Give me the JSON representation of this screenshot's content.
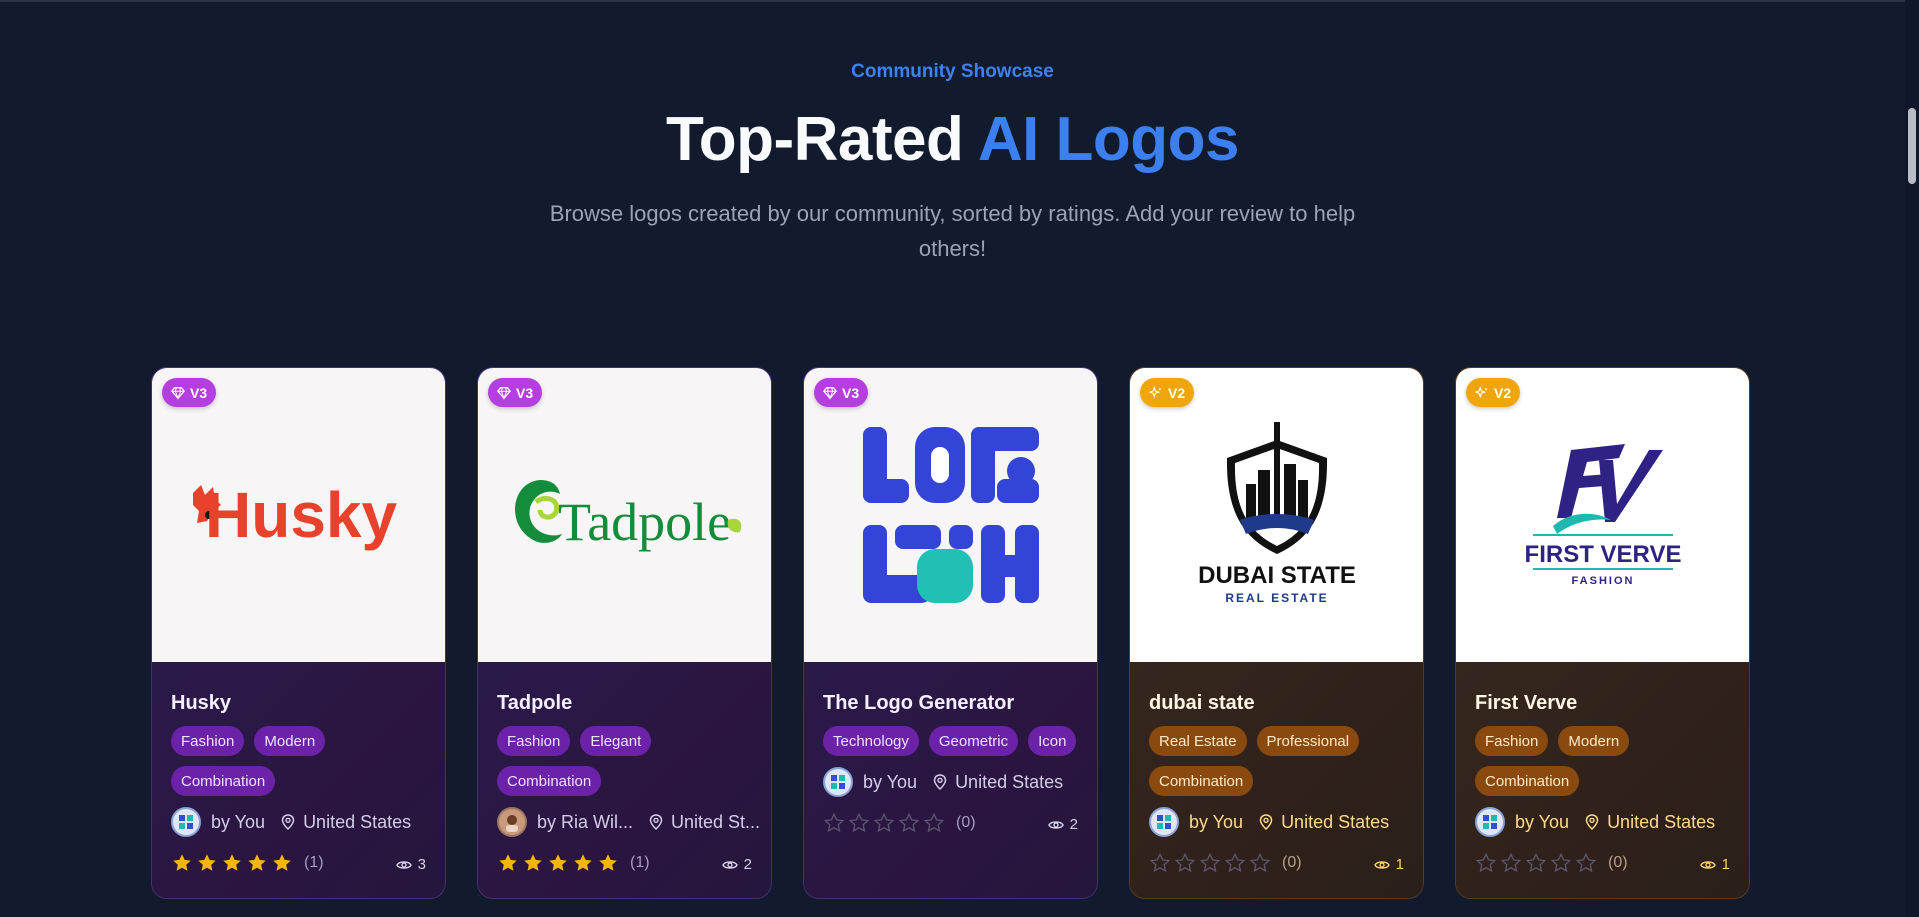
{
  "hero": {
    "eyebrow": "Community Showcase",
    "title_main": "Top-Rated",
    "title_accent": "AI Logos",
    "subtitle": "Browse logos created by our community, sorted by ratings. Add your review to help others!"
  },
  "colors": {
    "accent": "#3b7ff0",
    "v3_badge": "#b43ee0",
    "v2_badge": "#f0a50a",
    "star_filled": "#f5b50a"
  },
  "cards": [
    {
      "version": "V3",
      "logo_text": "Husky",
      "name": "Husky",
      "tags": [
        "Fashion",
        "Modern",
        "Combination"
      ],
      "author": "by You",
      "location": "United States",
      "rating": 5,
      "reviews": "(1)",
      "views": "3"
    },
    {
      "version": "V3",
      "logo_text": "Tadpole",
      "name": "Tadpole",
      "tags": [
        "Fashion",
        "Elegant",
        "Combination"
      ],
      "author": "by Ria Wil...",
      "location": "United St...",
      "rating": 5,
      "reviews": "(1)",
      "views": "2"
    },
    {
      "version": "V3",
      "logo_text": "",
      "name": "The Logo Generator",
      "tags": [
        "Technology",
        "Geometric",
        "Icon"
      ],
      "author": "by You",
      "location": "United States",
      "rating": 0,
      "reviews": "(0)",
      "views": "2"
    },
    {
      "version": "V2",
      "logo_text": "DUBAI STATE",
      "logo_subtext": "REAL ESTATE",
      "name": "dubai state",
      "tags": [
        "Real Estate",
        "Professional",
        "Combination"
      ],
      "author": "by You",
      "location": "United States",
      "rating": 0,
      "reviews": "(0)",
      "views": "1"
    },
    {
      "version": "V2",
      "logo_text": "FIRST VERVE",
      "logo_subtext": "FASHION",
      "name": "First Verve",
      "tags": [
        "Fashion",
        "Modern",
        "Combination"
      ],
      "author": "by You",
      "location": "United States",
      "rating": 0,
      "reviews": "(0)",
      "views": "1"
    }
  ]
}
